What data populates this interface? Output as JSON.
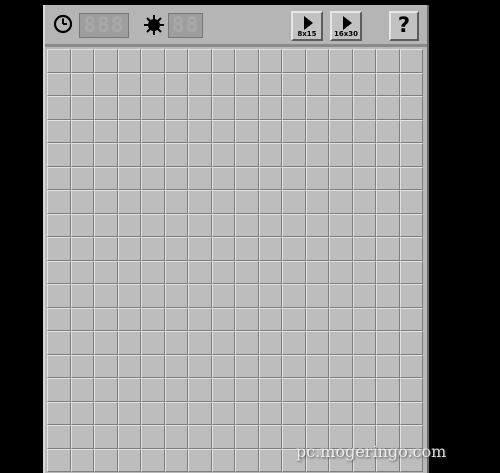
{
  "toolbar": {
    "timer_display": "888",
    "mine_counter_display": "88",
    "clock_icon": "clock-icon",
    "mine_icon": "mine-icon",
    "small_board_label": "8x15",
    "large_board_label": "16x30",
    "help_label": "?"
  },
  "board": {
    "cols": 16,
    "rows": 18,
    "state": "covered"
  },
  "watermark": "pc.mogeringo.com"
}
